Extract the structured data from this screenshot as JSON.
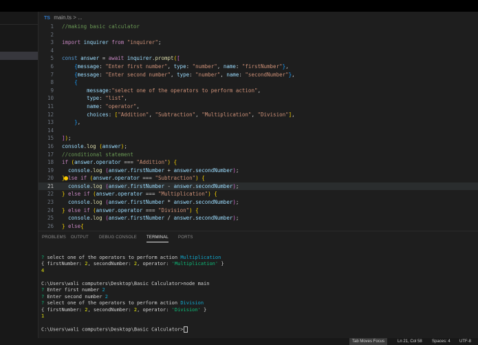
{
  "breadcrumb": {
    "file_badge": "TS",
    "file": "main.ts",
    "separator": "> ..."
  },
  "editor": {
    "lines": [
      {
        "n": "1",
        "tokens": [
          [
            "cm",
            "//making basic calculator"
          ]
        ]
      },
      {
        "n": "2",
        "tokens": []
      },
      {
        "n": "3",
        "tokens": [
          [
            "kw",
            "import "
          ],
          [
            "var",
            "inquirer "
          ],
          [
            "kw",
            "from "
          ],
          [
            "str",
            "\"inquirer\""
          ],
          [
            "pl",
            ";"
          ]
        ]
      },
      {
        "n": "4",
        "tokens": []
      },
      {
        "n": "5",
        "tokens": [
          [
            "kb",
            "const "
          ],
          [
            "var",
            "answer "
          ],
          [
            "pl",
            "= "
          ],
          [
            "kw",
            "await "
          ],
          [
            "var",
            "inquirer"
          ],
          [
            "pl",
            "."
          ],
          [
            "fn",
            "prompt"
          ],
          [
            "br1",
            "("
          ],
          [
            "br2",
            "["
          ]
        ]
      },
      {
        "n": "6",
        "tokens": [
          [
            "pl",
            "    "
          ],
          [
            "br3",
            "{"
          ],
          [
            "var",
            "message"
          ],
          [
            "pl",
            ": "
          ],
          [
            "str",
            "\"Enter first number\""
          ],
          [
            "pl",
            ", "
          ],
          [
            "var",
            "type"
          ],
          [
            "pl",
            ": "
          ],
          [
            "str",
            "\"number\""
          ],
          [
            "pl",
            ", "
          ],
          [
            "var",
            "name"
          ],
          [
            "pl",
            ": "
          ],
          [
            "str",
            "\"firstNumber\""
          ],
          [
            "br3",
            "}"
          ],
          [
            "pl",
            ","
          ]
        ]
      },
      {
        "n": "7",
        "tokens": [
          [
            "pl",
            "    "
          ],
          [
            "br3",
            "{"
          ],
          [
            "var",
            "message"
          ],
          [
            "pl",
            ": "
          ],
          [
            "str",
            "\"Enter second number\""
          ],
          [
            "pl",
            ", "
          ],
          [
            "var",
            "type"
          ],
          [
            "pl",
            ": "
          ],
          [
            "str",
            "\"number\""
          ],
          [
            "pl",
            ", "
          ],
          [
            "var",
            "name"
          ],
          [
            "pl",
            ": "
          ],
          [
            "str",
            "\"secondNumber\""
          ],
          [
            "br3",
            "}"
          ],
          [
            "pl",
            ","
          ]
        ]
      },
      {
        "n": "8",
        "tokens": [
          [
            "pl",
            "    "
          ],
          [
            "br3",
            "{"
          ]
        ]
      },
      {
        "n": "9",
        "tokens": [
          [
            "pl",
            "        "
          ],
          [
            "var",
            "message"
          ],
          [
            "pl",
            ":"
          ],
          [
            "str",
            "\"select one of the operators to perform action\""
          ],
          [
            "pl",
            ","
          ]
        ]
      },
      {
        "n": "10",
        "tokens": [
          [
            "pl",
            "        "
          ],
          [
            "var",
            "type"
          ],
          [
            "pl",
            ": "
          ],
          [
            "str",
            "\"list\""
          ],
          [
            "pl",
            ","
          ]
        ]
      },
      {
        "n": "11",
        "tokens": [
          [
            "pl",
            "        "
          ],
          [
            "var",
            "name"
          ],
          [
            "pl",
            ": "
          ],
          [
            "str",
            "\"operator\""
          ],
          [
            "pl",
            ","
          ]
        ]
      },
      {
        "n": "12",
        "tokens": [
          [
            "pl",
            "        "
          ],
          [
            "var",
            "choices"
          ],
          [
            "pl",
            ": "
          ],
          [
            "br1",
            "["
          ],
          [
            "str",
            "\"Addition\""
          ],
          [
            "pl",
            ", "
          ],
          [
            "str",
            "\"Subtraction\""
          ],
          [
            "pl",
            ", "
          ],
          [
            "str",
            "\"Multiplication\""
          ],
          [
            "pl",
            ", "
          ],
          [
            "str",
            "\"Division\""
          ],
          [
            "br1",
            "]"
          ],
          [
            "pl",
            ","
          ]
        ]
      },
      {
        "n": "13",
        "tokens": [
          [
            "pl",
            "    "
          ],
          [
            "br3",
            "}"
          ],
          [
            "pl",
            ","
          ]
        ]
      },
      {
        "n": "14",
        "tokens": []
      },
      {
        "n": "15",
        "tokens": [
          [
            "br2",
            "]"
          ],
          [
            "br1",
            ")"
          ],
          [
            "pl",
            ";"
          ]
        ]
      },
      {
        "n": "16",
        "tokens": [
          [
            "var",
            "console"
          ],
          [
            "pl",
            "."
          ],
          [
            "fn",
            "log "
          ],
          [
            "br1",
            "("
          ],
          [
            "var",
            "answer"
          ],
          [
            "br1",
            ")"
          ],
          [
            "pl",
            ";"
          ]
        ]
      },
      {
        "n": "17",
        "tokens": [
          [
            "cm",
            "//conditional statement"
          ]
        ]
      },
      {
        "n": "18",
        "tokens": [
          [
            "kw",
            "if "
          ],
          [
            "br1",
            "("
          ],
          [
            "var",
            "answer"
          ],
          [
            "pl",
            "."
          ],
          [
            "var",
            "operator "
          ],
          [
            "pl",
            "=== "
          ],
          [
            "str",
            "\"Addition\""
          ],
          [
            "br1",
            ")"
          ],
          [
            "pl",
            " "
          ],
          [
            "br1",
            "{"
          ]
        ]
      },
      {
        "n": "19",
        "tokens": [
          [
            "pl",
            "  "
          ],
          [
            "var",
            "console"
          ],
          [
            "pl",
            "."
          ],
          [
            "fn",
            "log "
          ],
          [
            "br2",
            "("
          ],
          [
            "var",
            "answer"
          ],
          [
            "pl",
            "."
          ],
          [
            "var",
            "firstNumber "
          ],
          [
            "pl",
            "+ "
          ],
          [
            "var",
            "answer"
          ],
          [
            "pl",
            "."
          ],
          [
            "var",
            "secondNumber"
          ],
          [
            "br2",
            ")"
          ],
          [
            "pl",
            ";"
          ]
        ]
      },
      {
        "n": "20",
        "tokens": [
          [
            "br1",
            "}"
          ],
          [
            "kw",
            "else if "
          ],
          [
            "br1",
            "("
          ],
          [
            "var",
            "answer"
          ],
          [
            "pl",
            "."
          ],
          [
            "var",
            "operator "
          ],
          [
            "pl",
            "=== "
          ],
          [
            "str",
            "\"Subtraction\""
          ],
          [
            "br1",
            ")"
          ],
          [
            "pl",
            " "
          ],
          [
            "br1",
            "{"
          ]
        ],
        "bulb": true
      },
      {
        "n": "21",
        "tokens": [
          [
            "pl",
            "  "
          ],
          [
            "var",
            "console"
          ],
          [
            "pl",
            "."
          ],
          [
            "fn",
            "log "
          ],
          [
            "br2",
            "("
          ],
          [
            "var",
            "answer"
          ],
          [
            "pl",
            "."
          ],
          [
            "var",
            "firstNumber "
          ],
          [
            "pl",
            "- "
          ],
          [
            "var",
            "answer"
          ],
          [
            "pl",
            "."
          ],
          [
            "var",
            "secondNumber"
          ],
          [
            "br2",
            ")"
          ],
          [
            "pl",
            ";"
          ]
        ],
        "active": true
      },
      {
        "n": "22",
        "tokens": [
          [
            "br1",
            "}"
          ],
          [
            "kw",
            " else if "
          ],
          [
            "br1",
            "("
          ],
          [
            "var",
            "answer"
          ],
          [
            "pl",
            "."
          ],
          [
            "var",
            "operator "
          ],
          [
            "pl",
            "=== "
          ],
          [
            "str",
            "\"Multiplication\""
          ],
          [
            "br1",
            ")"
          ],
          [
            "pl",
            " "
          ],
          [
            "br1",
            "{"
          ]
        ]
      },
      {
        "n": "23",
        "tokens": [
          [
            "pl",
            "  "
          ],
          [
            "var",
            "console"
          ],
          [
            "pl",
            "."
          ],
          [
            "fn",
            "log "
          ],
          [
            "br2",
            "("
          ],
          [
            "var",
            "answer"
          ],
          [
            "pl",
            "."
          ],
          [
            "var",
            "firstNumber "
          ],
          [
            "pl",
            "* "
          ],
          [
            "var",
            "answer"
          ],
          [
            "pl",
            "."
          ],
          [
            "var",
            "secondNumber"
          ],
          [
            "br2",
            ")"
          ],
          [
            "pl",
            ";"
          ]
        ]
      },
      {
        "n": "24",
        "tokens": [
          [
            "br1",
            "}"
          ],
          [
            "kw",
            " else if "
          ],
          [
            "br1",
            "("
          ],
          [
            "var",
            "answer"
          ],
          [
            "pl",
            "."
          ],
          [
            "var",
            "operator "
          ],
          [
            "pl",
            "=== "
          ],
          [
            "str",
            "\"Division\""
          ],
          [
            "br1",
            ")"
          ],
          [
            "pl",
            " "
          ],
          [
            "br1",
            "{"
          ]
        ]
      },
      {
        "n": "25",
        "tokens": [
          [
            "pl",
            "  "
          ],
          [
            "var",
            "console"
          ],
          [
            "pl",
            "."
          ],
          [
            "fn",
            "log "
          ],
          [
            "br2",
            "("
          ],
          [
            "var",
            "answer"
          ],
          [
            "pl",
            "."
          ],
          [
            "var",
            "firstNumber "
          ],
          [
            "pl",
            "/ "
          ],
          [
            "var",
            "answer"
          ],
          [
            "pl",
            "."
          ],
          [
            "var",
            "secondNumber"
          ],
          [
            "br2",
            ")"
          ],
          [
            "pl",
            ";"
          ]
        ]
      },
      {
        "n": "26",
        "tokens": [
          [
            "br1",
            "}"
          ],
          [
            "kw",
            " else"
          ],
          [
            "br1",
            "{"
          ]
        ]
      }
    ]
  },
  "panel": {
    "tabs": [
      {
        "label": "PROBLEMS",
        "active": false
      },
      {
        "label": "OUTPUT",
        "active": false
      },
      {
        "label": "DEBUG CONSOLE",
        "active": false
      },
      {
        "label": "TERMINAL",
        "active": true
      },
      {
        "label": "PORTS",
        "active": false
      }
    ]
  },
  "terminal": {
    "lines": [
      [
        [
          "pl",
          ""
        ]
      ],
      [
        [
          "q",
          "? "
        ],
        [
          "pl",
          "select one of the operators to perform action "
        ],
        [
          "ans",
          "Multiplication"
        ]
      ],
      [
        [
          "pl",
          "{ firstNumber: "
        ],
        [
          "tnum",
          "2"
        ],
        [
          "pl",
          ", secondNumber: "
        ],
        [
          "tnum",
          "2"
        ],
        [
          "pl",
          ", operator: "
        ],
        [
          "tstr",
          "'Multiplication'"
        ],
        [
          "pl",
          " }"
        ]
      ],
      [
        [
          "tnum",
          "4"
        ]
      ],
      [
        [
          "pl",
          ""
        ]
      ],
      [
        [
          "pl",
          "C:\\Users\\wali computers\\Desktop\\Basic Calculator>node main"
        ]
      ],
      [
        [
          "q",
          "? "
        ],
        [
          "pl",
          "Enter first number "
        ],
        [
          "ans",
          "2"
        ]
      ],
      [
        [
          "q",
          "? "
        ],
        [
          "pl",
          "Enter second number "
        ],
        [
          "ans",
          "2"
        ]
      ],
      [
        [
          "q",
          "? "
        ],
        [
          "pl",
          "select one of the operators to perform action "
        ],
        [
          "ans",
          "Division"
        ]
      ],
      [
        [
          "pl",
          "{ firstNumber: "
        ],
        [
          "tnum",
          "2"
        ],
        [
          "pl",
          ", secondNumber: "
        ],
        [
          "tnum",
          "2"
        ],
        [
          "pl",
          ", operator: "
        ],
        [
          "tstr",
          "'Division'"
        ],
        [
          "pl",
          " }"
        ]
      ],
      [
        [
          "tnum",
          "1"
        ]
      ],
      [
        [
          "pl",
          ""
        ]
      ],
      [
        [
          "pl",
          "C:\\Users\\wali computers\\Desktop\\Basic Calculator>"
        ]
      ]
    ]
  },
  "statusbar": {
    "tab_focus": "Tab Moves Focus",
    "position": "Ln 21, Col 58",
    "spaces": "Spaces: 4",
    "encoding": "UTF-8"
  }
}
